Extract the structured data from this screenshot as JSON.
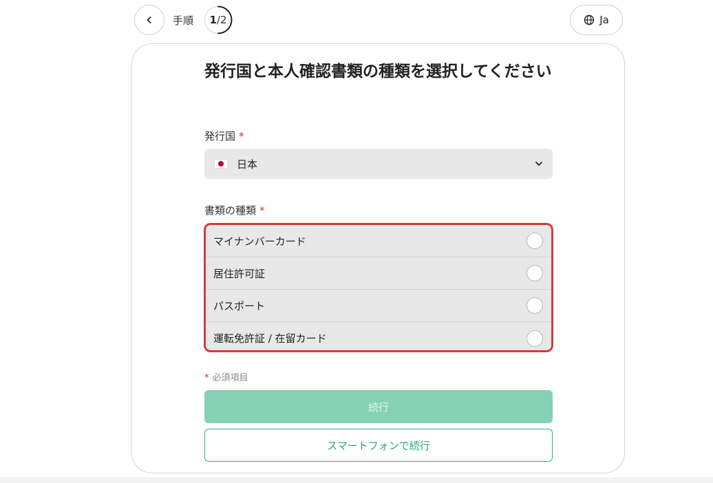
{
  "header": {
    "step_label": "手順",
    "step_current": "1",
    "step_separator": "/",
    "step_total": "2",
    "step_progress": 0.5,
    "language_label": "Ja"
  },
  "form": {
    "title": "発行国と本人確認書類の種類を選択してください",
    "country_label": "発行国",
    "country_value": "日本",
    "doc_type_label": "書類の種類",
    "required_marker": "*",
    "doc_types": [
      {
        "label": "マイナンバーカード",
        "selected": false
      },
      {
        "label": "居住許可証",
        "selected": false
      },
      {
        "label": "パスポート",
        "selected": false
      },
      {
        "label": "運転免許証 / 在留カード",
        "selected": false
      }
    ],
    "required_note": "必須項目",
    "continue_label": "続行",
    "continue_phone_label": "スマートフォンで続行"
  },
  "colors": {
    "accent": "#2db383",
    "continue_disabled": "#84d1b5",
    "required": "#d12c2c",
    "highlight": "#d83a3a"
  },
  "icons": {
    "back": "chevron-left-icon",
    "language": "globe-icon",
    "flag": "japan-flag-icon",
    "dropdown": "chevron-down-icon"
  }
}
